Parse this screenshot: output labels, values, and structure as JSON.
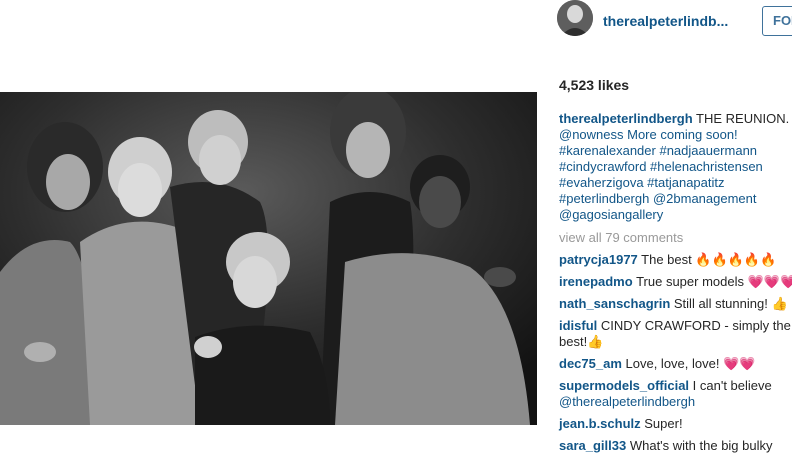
{
  "post": {
    "author_username": "therealpeterlindb...",
    "follow_label": "FOLLO",
    "likes": "4,523 likes"
  },
  "caption": {
    "username": "therealpeterlindbergh",
    "lines": [
      "THE REUNION.",
      "@nowness More coming soon!",
      "#karenalexander #nadjaauermann",
      "#cindycrawford #helenachristensen",
      "#evaherzigova #tatjanapatitz",
      "#peterlindbergh @2bmanagement",
      "@gagosiangallery"
    ]
  },
  "view_all": "view all 79 comments",
  "comments": [
    {
      "username": "patrycja1977",
      "text": "The best 🔥🔥🔥🔥🔥"
    },
    {
      "username": "irenepadmo",
      "text": "True super models 💗💗💗"
    },
    {
      "username": "nath_sanschagrin",
      "text": "Still all stunning! 👍"
    },
    {
      "username": "idisful",
      "text": "CINDY CRAWFORD - simply the",
      "text2": "best!👍"
    },
    {
      "username": "dec75_am",
      "text": "Love, love, love! 💗💗"
    },
    {
      "username": "supermodels_official",
      "text": "I can't believe",
      "text2": "@therealpeterlindbergh"
    },
    {
      "username": "jean.b.schulz",
      "text": "Super!"
    },
    {
      "username": "sara_gill33",
      "text": "What's with the big bulky"
    }
  ],
  "icons": {
    "avatar": "user-avatar-photo",
    "photo": "group-portrait-photo"
  },
  "colors": {
    "link": "#125688",
    "follow": "#3f729b",
    "muted": "#999999",
    "text": "#262626"
  }
}
